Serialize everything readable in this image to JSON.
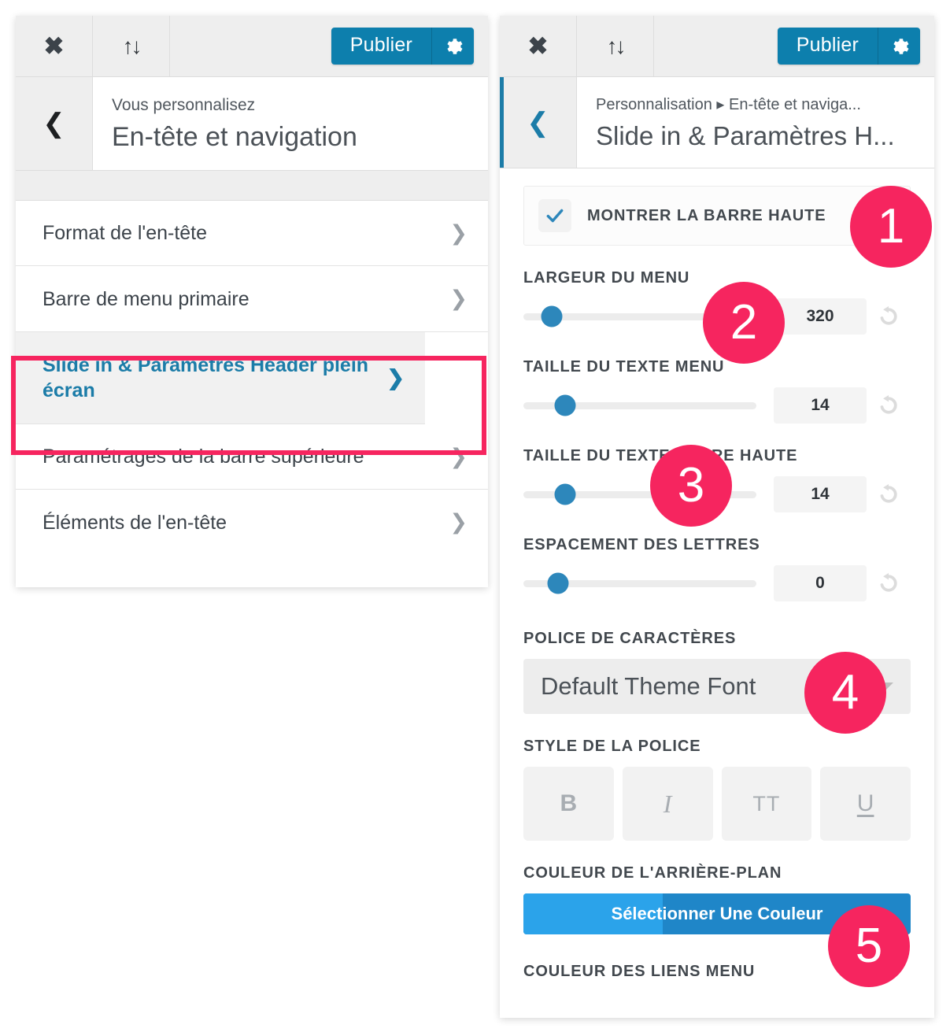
{
  "toolbar": {
    "close_icon": "close-icon",
    "devices_icon": "switch-device-icon",
    "publish_label": "Publier",
    "gear_icon": "gear-icon"
  },
  "left_panel": {
    "back_icon": "chevron-left-icon",
    "kicker": "Vous personnalisez",
    "title": "En-tête et navigation",
    "menu_items": [
      {
        "label": "Format de l'en-tête",
        "selected": false
      },
      {
        "label": "Barre de menu primaire",
        "selected": false
      },
      {
        "label": "Slide in & Paramètres Header plein écran",
        "selected": true
      },
      {
        "label": "Paramétrages de la barre supérieure",
        "selected": false
      },
      {
        "label": "Éléments de l'en-tête",
        "selected": false
      }
    ],
    "chevron_icon": "chevron-right-icon",
    "highlight_color": "#f6255f"
  },
  "right_panel": {
    "back_icon": "chevron-left-icon",
    "breadcrumb": "Personnalisation ▸ En-tête et naviga...",
    "title": "Slide in & Paramètres H...",
    "checkbox": {
      "label": "MONTRER LA BARRE HAUTE",
      "checked": true,
      "icon": "checkmark-icon"
    },
    "sliders": [
      {
        "label": "LARGEUR DU MENU",
        "value": "320",
        "percent": 12
      },
      {
        "label": "TAILLE DU TEXTE MENU",
        "value": "14",
        "percent": 18
      },
      {
        "label": "TAILLE DU TEXTE BARRE HAUTE",
        "value": "14",
        "percent": 18
      },
      {
        "label": "ESPACEMENT DES LETTRES",
        "value": "0",
        "percent": 15
      }
    ],
    "reset_icon": "undo-reset-icon",
    "font": {
      "label": "POLICE DE CARACTÈRES",
      "value": "Default Theme Font",
      "caret_icon": "chevron-down-icon"
    },
    "font_style": {
      "label": "STYLE DE LA POLICE",
      "buttons": [
        {
          "glyph": "B",
          "name": "bold"
        },
        {
          "glyph": "I",
          "name": "italic"
        },
        {
          "glyph": "TT",
          "name": "uppercase"
        },
        {
          "glyph": "U",
          "name": "underline"
        }
      ]
    },
    "background_color": {
      "label": "COULEUR DE L'ARRIÈRE-PLAN",
      "button_label": "Sélectionner Une Couleur",
      "swatch_color": "#2ba3ea",
      "button_color": "#1f86c8"
    },
    "menu_link_color": {
      "label": "COULEUR DES LIENS MENU"
    }
  },
  "badges": [
    {
      "number": "1"
    },
    {
      "number": "2"
    },
    {
      "number": "3"
    },
    {
      "number": "4"
    },
    {
      "number": "5"
    }
  ],
  "colors": {
    "accent_blue": "#0d7fad",
    "badge_pink": "#f6255f",
    "slider_blue": "#2d87bb"
  }
}
